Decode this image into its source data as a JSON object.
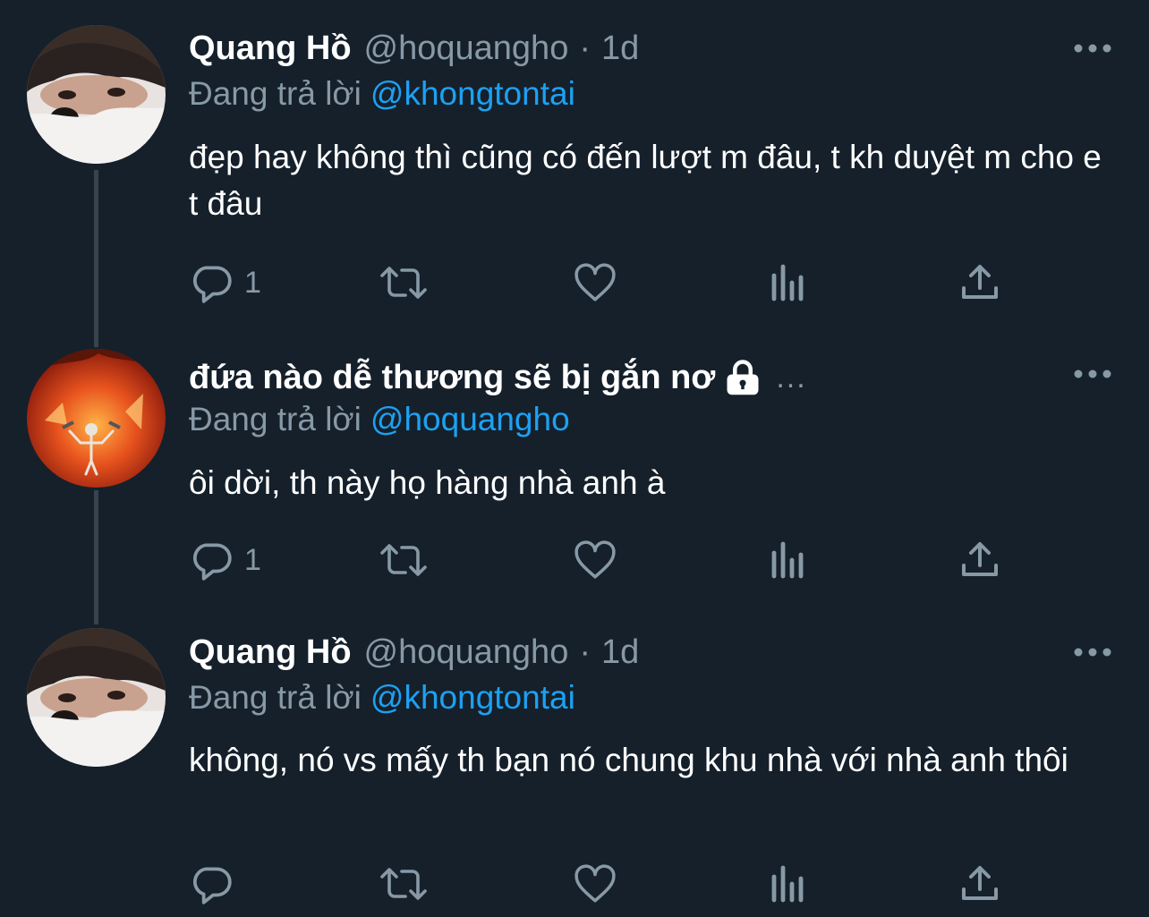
{
  "tweets": [
    {
      "name": "Quang Hồ",
      "handle": "@hoquangho",
      "sep": "·",
      "time": "1d",
      "reply_prefix": "Đang trả lời",
      "reply_to": "@khongtontai",
      "text": "đẹp hay không thì cũng có đến lượt m đâu, t kh duyệt m cho e t đâu",
      "reply_count": "1"
    },
    {
      "name": "đứa nào dễ thương sẽ bị gắn nơ",
      "name_suffix": "...",
      "reply_prefix": "Đang trả lời",
      "reply_to": "@hoquangho",
      "text": "ôi dời, th này họ hàng nhà anh à",
      "reply_count": "1"
    },
    {
      "name": "Quang Hồ",
      "handle": "@hoquangho",
      "sep": "·",
      "time": "1d",
      "reply_prefix": "Đang trả lời",
      "reply_to": "@khongtontai",
      "text": "không, nó vs mấy th bạn nó chung khu nhà với nhà anh thôi",
      "reply_count": ""
    }
  ],
  "icons": {
    "reply": "reply-icon",
    "retweet": "retweet-icon",
    "like": "heart-icon",
    "analytics": "analytics-icon",
    "share": "share-icon",
    "more": "more-icon",
    "lock": "lock-icon"
  },
  "colors": {
    "background": "#15202b",
    "primary_text": "#ffffff",
    "secondary_text": "#8899a6",
    "link": "#1da1f2",
    "thread_line": "#38444d"
  }
}
